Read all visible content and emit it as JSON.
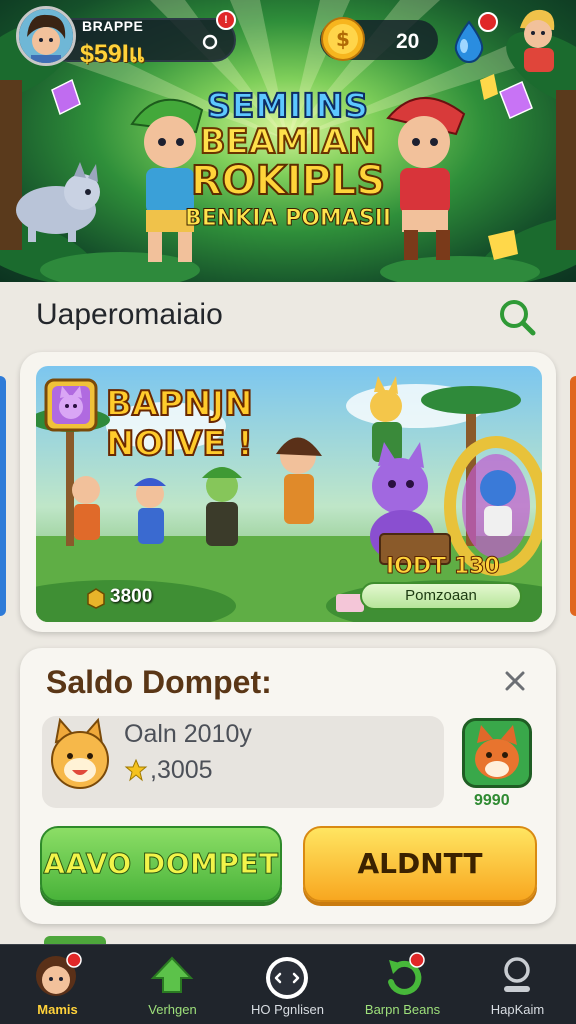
{
  "header": {
    "player_name": "BRAPPE",
    "balance": "$59Iแ",
    "notification_badge": "!",
    "coins": "20"
  },
  "hero": {
    "title_line1": "SEMIINS",
    "title_line2": "BEAMIAN",
    "title_line3": "ROKIPLS",
    "subtitle": "BENKIA POMASII"
  },
  "section": {
    "title": "Uaperomaiaio"
  },
  "promo": {
    "title_line1": "BAPNJN",
    "title_line2": "NOIVE !",
    "count": "3800",
    "price": "IODT 130",
    "button_label": "Pomzoaan"
  },
  "wallet": {
    "title": "Saldo Dompet:",
    "line1": "Oaln 2010y",
    "line2": ",3005",
    "item_count": "9990",
    "primary_button": "AAVO DOMPET",
    "secondary_button": "ALDNTT"
  },
  "nav": {
    "items": [
      {
        "label": "Mamis"
      },
      {
        "label": "Verhgen"
      },
      {
        "label": "HO Pgnlisen"
      },
      {
        "label": "Barpn Beans"
      },
      {
        "label": "HapKaim"
      }
    ]
  },
  "colors": {
    "accent_green": "#49b33a",
    "accent_orange": "#f8a720",
    "gold": "#ffd23a",
    "nav_bg": "#20252c"
  }
}
